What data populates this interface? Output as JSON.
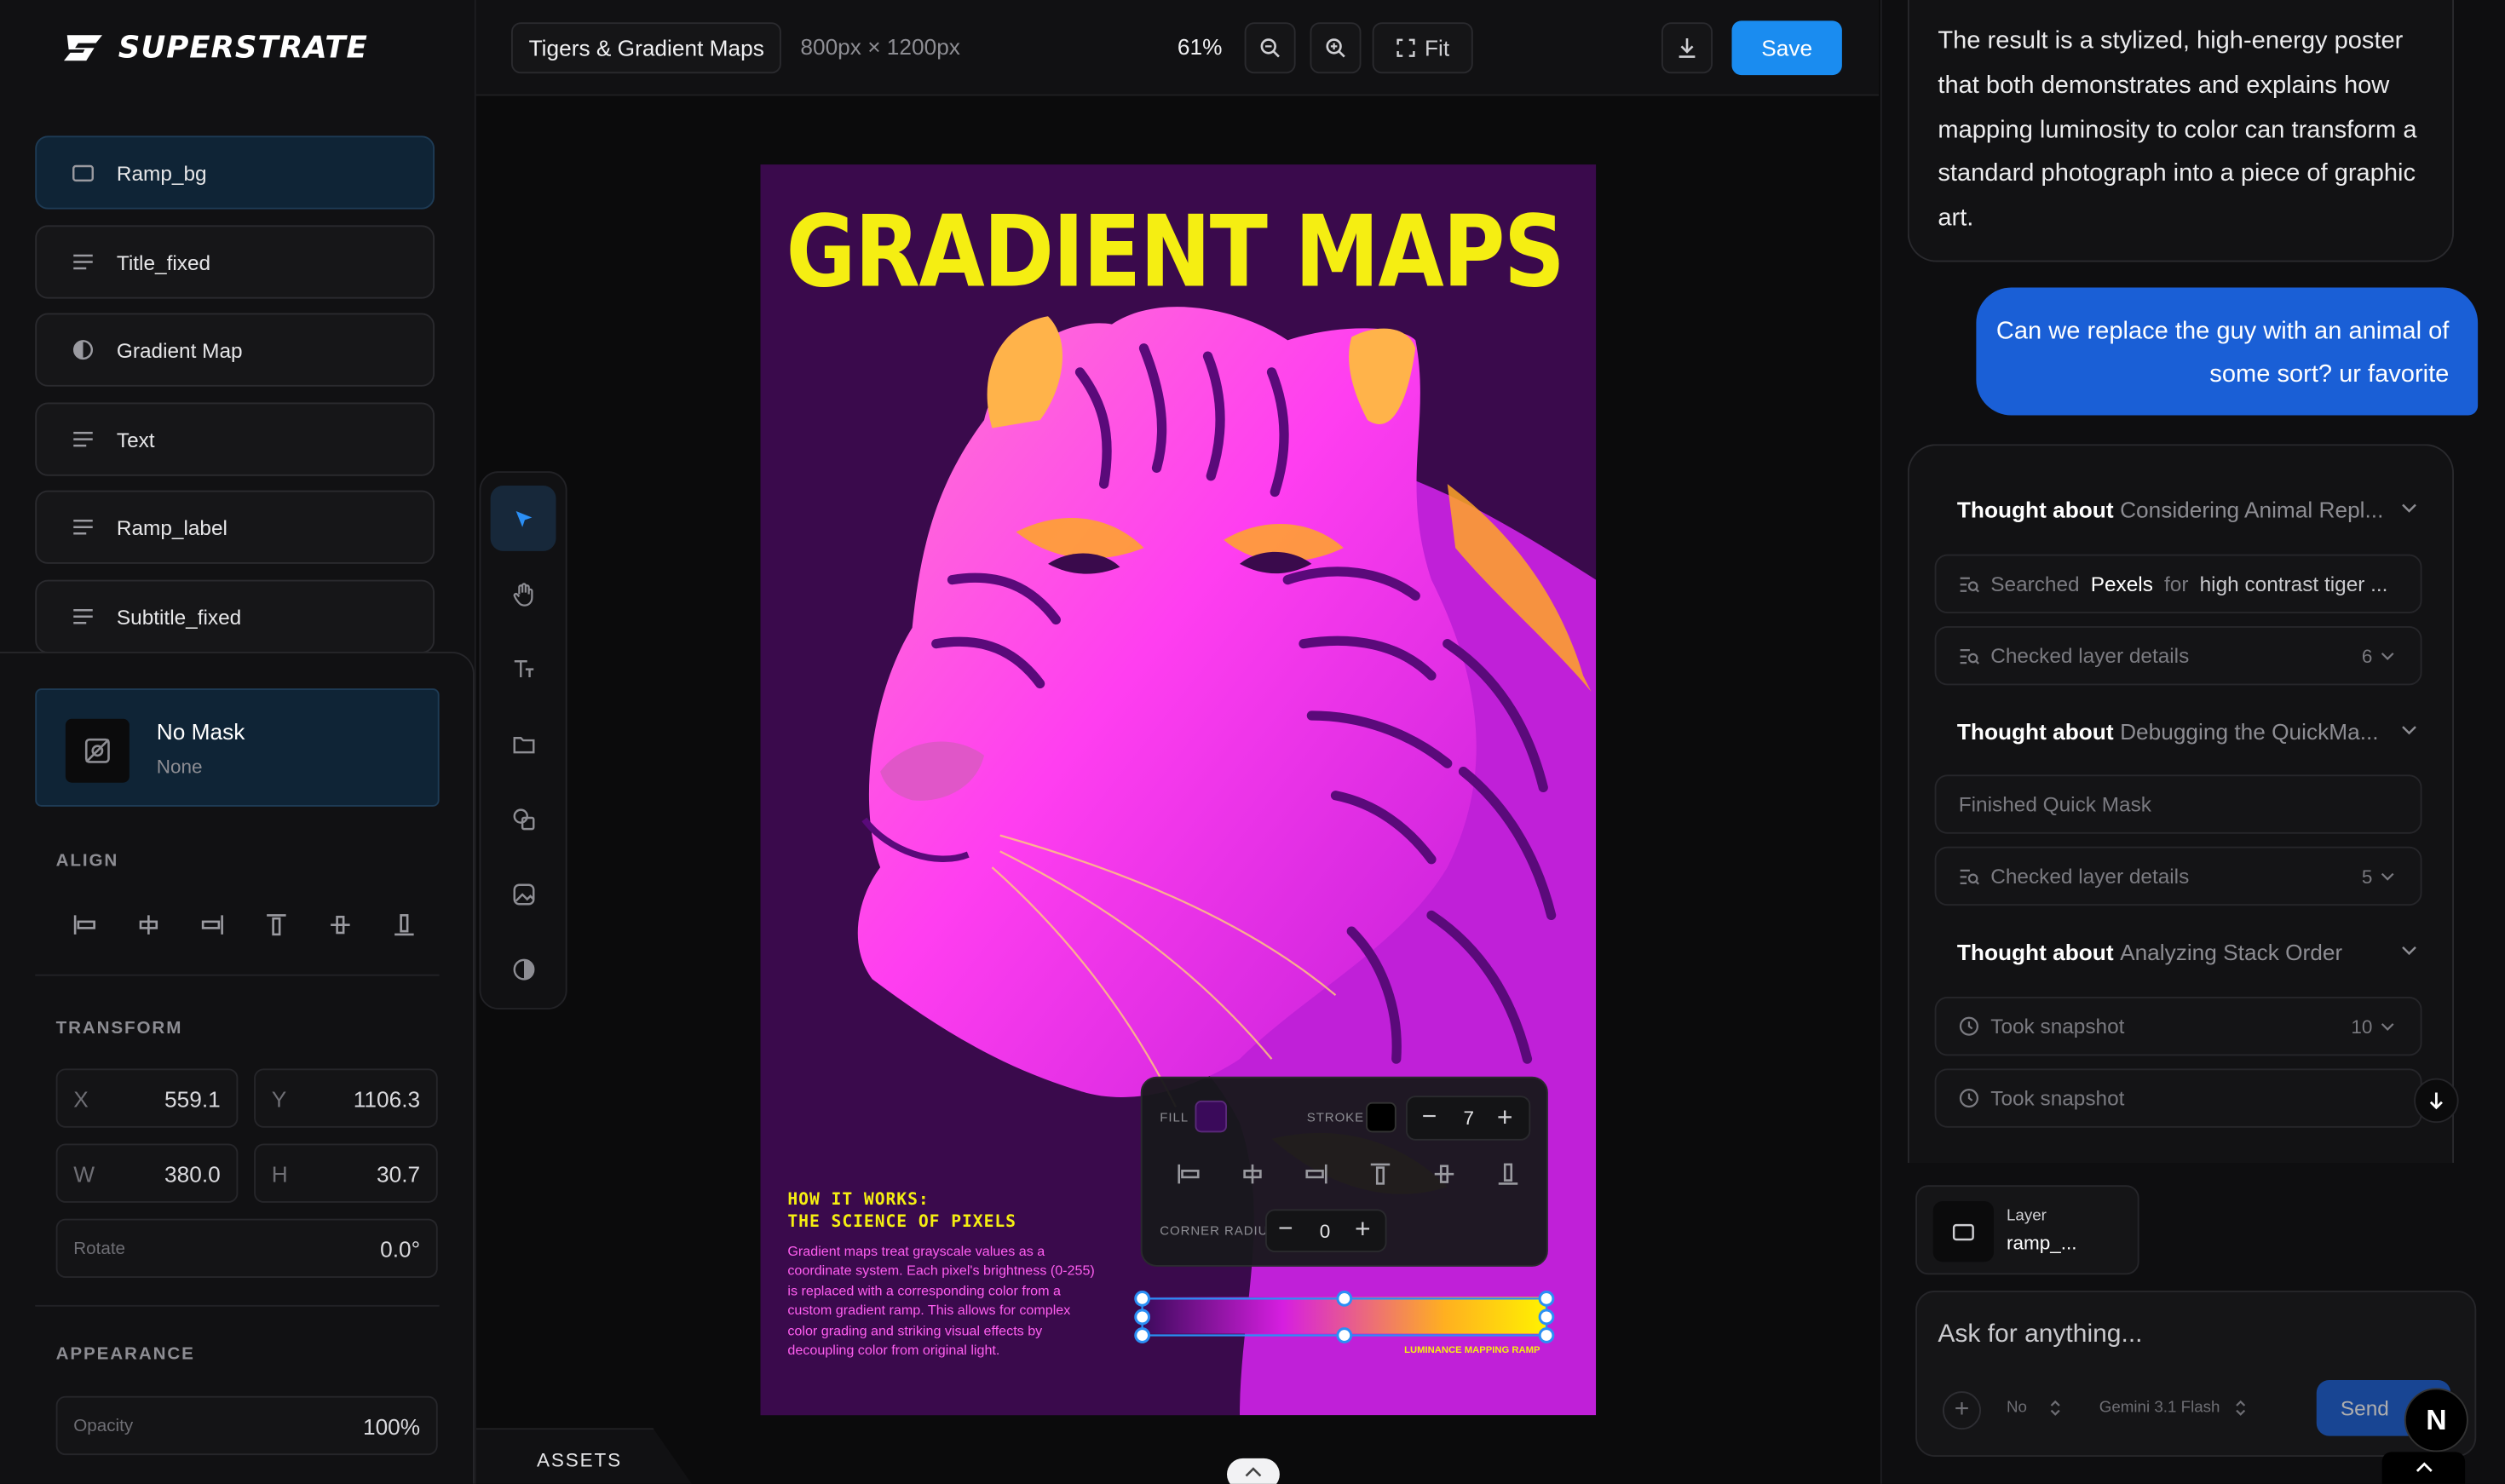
{
  "app": {
    "name": "SUPERSTRATE"
  },
  "layers": [
    {
      "name": "Ramp_bg",
      "icon": "rectangle-icon",
      "selected": true
    },
    {
      "name": "Title_fixed",
      "icon": "text-lines-icon",
      "selected": false
    },
    {
      "name": "Gradient Map",
      "icon": "half-circle-icon",
      "selected": false
    },
    {
      "name": "Text",
      "icon": "text-lines-icon",
      "selected": false
    },
    {
      "name": "Ramp_label",
      "icon": "text-lines-icon",
      "selected": false
    },
    {
      "name": "Subtitle_fixed",
      "icon": "text-lines-icon",
      "selected": false
    }
  ],
  "mask": {
    "title": "No Mask",
    "subtitle": "None"
  },
  "properties": {
    "align_label": "ALIGN",
    "transform_label": "TRANSFORM",
    "x_label": "X",
    "x": "559.1",
    "y_label": "Y",
    "y": "1106.3",
    "w_label": "W",
    "w": "380.0",
    "h_label": "H",
    "h": "30.7",
    "rotate_label": "Rotate",
    "rotate": "0.0°",
    "appearance_label": "APPEARANCE",
    "opacity_label": "Opacity",
    "opacity": "100%"
  },
  "toolbar": {
    "doc_name": "Tigers & Gradient Maps",
    "doc_size": "800px × 1200px",
    "zoom": "61%",
    "fit_label": "Fit",
    "save_label": "Save"
  },
  "assets_tab": "ASSETS",
  "poster": {
    "title": "GRADIENT MAPS",
    "heading_line1": "HOW IT WORKS:",
    "heading_line2": "THE SCIENCE OF PIXELS",
    "body": "Gradient maps treat grayscale values as a coordinate system. Each pixel's brightness (0-255) is replaced with a corresponding color from a custom gradient ramp. This allows for complex color grading and striking visual effects by decoupling color from original light.",
    "ramp_label": "LUMINANCE MAPPING RAMP",
    "colors": {
      "bg": "#3a0a4c",
      "accent": "#f5ee12",
      "magenta": "#ff3ef0"
    }
  },
  "float_panel": {
    "fill_label": "FILL",
    "fill_color": "#3a0a5a",
    "stroke_label": "STROKE",
    "stroke_color": "#000000",
    "stroke_width": "7",
    "corner_label": "CORNER RADIUS",
    "corner_radius": "0"
  },
  "chat": {
    "assistant_text": "The result is a stylized, high-energy poster that both demonstrates and explains how mapping luminosity to color can transform a standard photograph into a piece of graphic art.",
    "user_text": "Can we replace the guy with an animal of some sort? ur favorite",
    "thought_prefix": "Thought about",
    "thought1": "Considering Animal Repl...",
    "search_prefix": "Searched",
    "search_source": "Pexels",
    "search_for": "for",
    "search_query": "high contrast tiger ...",
    "checked1": "Checked layer details",
    "checked1_count": "6",
    "thought2": "Debugging the QuickMa...",
    "finished_mask": "Finished Quick Mask",
    "checked2": "Checked layer details",
    "checked2_count": "5",
    "thought3": "Analyzing Stack Order",
    "snapshot1": "Took snapshot",
    "snapshot1_count": "10",
    "snapshot2": "Took snapshot",
    "context_kind": "Layer",
    "context_name": "ramp_...",
    "input_placeholder": "Ask for anything...",
    "mode": "No",
    "model": "Gemini 3.1 Flash",
    "send_label": "Send",
    "colors": {
      "user_bubble": "#1a5fd6",
      "send": "#1a5fd6"
    }
  }
}
